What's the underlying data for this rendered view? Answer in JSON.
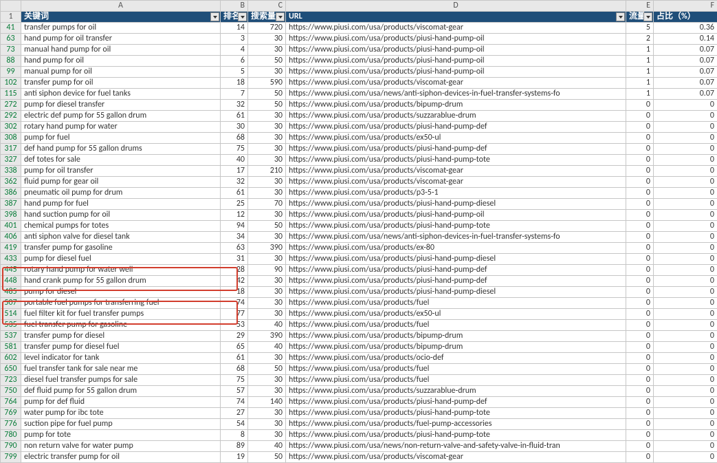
{
  "colheaders": [
    "A",
    "B",
    "C",
    "D",
    "E",
    "F"
  ],
  "headers": {
    "B": "排名",
    "A": "关键词",
    "C": "搜索量",
    "D": "URL",
    "E": "流量",
    "F": "占比（%）"
  },
  "rows": [
    {
      "n": 41,
      "A": "transfer pumps for oil",
      "B": 14,
      "C": 720,
      "D": "https://www.piusi.com/usa/products/viscomat-gear",
      "E": 5,
      "F": "0.36"
    },
    {
      "n": 63,
      "A": "hand pump for oil transfer",
      "B": 3,
      "C": 30,
      "D": "https://www.piusi.com/usa/products/piusi-hand-pump-oil",
      "E": 2,
      "F": "0.14"
    },
    {
      "n": 73,
      "A": "manual hand pump for oil",
      "B": 4,
      "C": 30,
      "D": "https://www.piusi.com/usa/products/piusi-hand-pump-oil",
      "E": 1,
      "F": "0.07"
    },
    {
      "n": 88,
      "A": "hand pump for oil",
      "B": 6,
      "C": 50,
      "D": "https://www.piusi.com/usa/products/piusi-hand-pump-oil",
      "E": 1,
      "F": "0.07"
    },
    {
      "n": 99,
      "A": "manual pump for oil",
      "B": 5,
      "C": 30,
      "D": "https://www.piusi.com/usa/products/piusi-hand-pump-oil",
      "E": 1,
      "F": "0.07"
    },
    {
      "n": 102,
      "A": "transfer pump for oil",
      "B": 18,
      "C": 590,
      "D": "https://www.piusi.com/usa/products/viscomat-gear",
      "E": 1,
      "F": "0.07"
    },
    {
      "n": 115,
      "A": "anti siphon device for fuel tanks",
      "B": 7,
      "C": 50,
      "D": "https://www.piusi.com/usa/news/anti-siphon-devices-in-fuel-transfer-systems-fo",
      "E": 1,
      "F": "0.07"
    },
    {
      "n": 272,
      "A": "pump for diesel transfer",
      "B": 32,
      "C": 50,
      "D": "https://www.piusi.com/usa/products/bipump-drum",
      "E": 0,
      "F": "0"
    },
    {
      "n": 292,
      "A": "electric def pump for 55 gallon drum",
      "B": 61,
      "C": 30,
      "D": "https://www.piusi.com/usa/products/suzzarablue-drum",
      "E": 0,
      "F": "0"
    },
    {
      "n": 302,
      "A": "rotary hand pump for water",
      "B": 30,
      "C": 30,
      "D": "https://www.piusi.com/usa/products/piusi-hand-pump-def",
      "E": 0,
      "F": "0"
    },
    {
      "n": 308,
      "A": "pump for fuel",
      "B": 68,
      "C": 30,
      "D": "https://www.piusi.com/usa/products/ex50-ul",
      "E": 0,
      "F": "0"
    },
    {
      "n": 317,
      "A": "def hand pump for 55 gallon drums",
      "B": 75,
      "C": 30,
      "D": "https://www.piusi.com/usa/products/piusi-hand-pump-def",
      "E": 0,
      "F": "0"
    },
    {
      "n": 327,
      "A": "def totes for sale",
      "B": 40,
      "C": 30,
      "D": "https://www.piusi.com/usa/products/piusi-hand-pump-tote",
      "E": 0,
      "F": "0"
    },
    {
      "n": 338,
      "A": "pump for oil transfer",
      "B": 17,
      "C": 210,
      "D": "https://www.piusi.com/usa/products/viscomat-gear",
      "E": 0,
      "F": "0"
    },
    {
      "n": 362,
      "A": "fluid pump for gear oil",
      "B": 32,
      "C": 30,
      "D": "https://www.piusi.com/usa/products/viscomat-gear",
      "E": 0,
      "F": "0"
    },
    {
      "n": 386,
      "A": "pneumatic oil pump for drum",
      "B": 61,
      "C": 30,
      "D": "https://www.piusi.com/usa/products/p3-5-1",
      "E": 0,
      "F": "0"
    },
    {
      "n": 387,
      "A": "hand pump for fuel",
      "B": 25,
      "C": 70,
      "D": "https://www.piusi.com/usa/products/piusi-hand-pump-diesel",
      "E": 0,
      "F": "0"
    },
    {
      "n": 398,
      "A": "hand suction pump for oil",
      "B": 12,
      "C": 30,
      "D": "https://www.piusi.com/usa/products/piusi-hand-pump-oil",
      "E": 0,
      "F": "0"
    },
    {
      "n": 401,
      "A": "chemical pumps for totes",
      "B": 94,
      "C": 50,
      "D": "https://www.piusi.com/usa/products/piusi-hand-pump-tote",
      "E": 0,
      "F": "0"
    },
    {
      "n": 406,
      "A": "anti siphon valve for diesel tank",
      "B": 34,
      "C": 30,
      "D": "https://www.piusi.com/usa/news/anti-siphon-devices-in-fuel-transfer-systems-fo",
      "E": 0,
      "F": "0"
    },
    {
      "n": 419,
      "A": "transfer pump for gasoline",
      "B": 63,
      "C": 390,
      "D": "https://www.piusi.com/usa/products/ex-80",
      "E": 0,
      "F": "0"
    },
    {
      "n": 433,
      "A": "pump for diesel fuel",
      "B": 31,
      "C": 30,
      "D": "https://www.piusi.com/usa/products/piusi-hand-pump-diesel",
      "E": 0,
      "F": "0"
    },
    {
      "n": 445,
      "A": "rotary hand pump for water well",
      "B": 28,
      "C": 90,
      "D": "https://www.piusi.com/usa/products/piusi-hand-pump-def",
      "E": 0,
      "F": "0"
    },
    {
      "n": 448,
      "A": "hand crank pump for 55 gallon drum",
      "B": 42,
      "C": 30,
      "D": "https://www.piusi.com/usa/products/piusi-hand-pump-def",
      "E": 0,
      "F": "0"
    },
    {
      "n": 485,
      "A": "pump for diesel",
      "B": 18,
      "C": 30,
      "D": "https://www.piusi.com/usa/products/piusi-hand-pump-diesel",
      "E": 0,
      "F": "0"
    },
    {
      "n": 507,
      "A": "portable fuel pumps for transferring fuel",
      "B": 74,
      "C": 30,
      "D": "https://www.piusi.com/usa/products/fuel",
      "E": 0,
      "F": "0"
    },
    {
      "n": 514,
      "A": "fuel filter kit for fuel transfer pumps",
      "B": 77,
      "C": 30,
      "D": "https://www.piusi.com/usa/products/ex50-ul",
      "E": 0,
      "F": "0"
    },
    {
      "n": 535,
      "A": "fuel transfer pump for gasoline",
      "B": 53,
      "C": 40,
      "D": "https://www.piusi.com/usa/products/fuel",
      "E": 0,
      "F": "0"
    },
    {
      "n": 537,
      "A": "transfer pump for diesel",
      "B": 29,
      "C": 390,
      "D": "https://www.piusi.com/usa/products/bipump-drum",
      "E": 0,
      "F": "0"
    },
    {
      "n": 581,
      "A": "transfer pump for diesel fuel",
      "B": 65,
      "C": 40,
      "D": "https://www.piusi.com/usa/products/bipump-drum",
      "E": 0,
      "F": "0"
    },
    {
      "n": 602,
      "A": "level indicator for tank",
      "B": 61,
      "C": 30,
      "D": "https://www.piusi.com/usa/products/ocio-def",
      "E": 0,
      "F": "0"
    },
    {
      "n": 650,
      "A": "fuel transfer tank for sale near me",
      "B": 68,
      "C": 50,
      "D": "https://www.piusi.com/usa/products/fuel",
      "E": 0,
      "F": "0"
    },
    {
      "n": 723,
      "A": "diesel fuel transfer pumps for sale",
      "B": 75,
      "C": 30,
      "D": "https://www.piusi.com/usa/products/fuel",
      "E": 0,
      "F": "0"
    },
    {
      "n": 750,
      "A": "def fluid pump for 55 gallon drum",
      "B": 57,
      "C": 30,
      "D": "https://www.piusi.com/usa/products/suzzarablue-drum",
      "E": 0,
      "F": "0"
    },
    {
      "n": 764,
      "A": "pump for def fluid",
      "B": 74,
      "C": 140,
      "D": "https://www.piusi.com/usa/products/piusi-hand-pump-def",
      "E": 0,
      "F": "0"
    },
    {
      "n": 769,
      "A": "water pump for ibc tote",
      "B": 27,
      "C": 30,
      "D": "https://www.piusi.com/usa/products/piusi-hand-pump-tote",
      "E": 0,
      "F": "0"
    },
    {
      "n": 776,
      "A": "suction pipe for fuel pump",
      "B": 54,
      "C": 30,
      "D": "https://www.piusi.com/usa/products/fuel-pump-accessories",
      "E": 0,
      "F": "0"
    },
    {
      "n": 780,
      "A": "pump for tote",
      "B": 8,
      "C": 30,
      "D": "https://www.piusi.com/usa/products/piusi-hand-pump-tote",
      "E": 0,
      "F": "0"
    },
    {
      "n": 790,
      "A": "non return valve for water pump",
      "B": 89,
      "C": 40,
      "D": "https://www.piusi.com/usa/news/non-return-valve-and-safety-valve-in-fluid-tran",
      "E": 0,
      "F": "0"
    },
    {
      "n": 799,
      "A": "electric transfer pump for oil",
      "B": 19,
      "C": 50,
      "D": "https://www.piusi.com/usa/products/viscomat-gear",
      "E": 0,
      "F": "0"
    }
  ]
}
